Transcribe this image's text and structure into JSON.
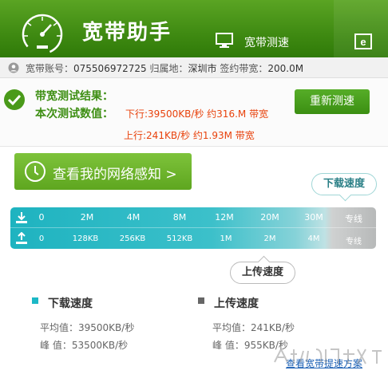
{
  "header": {
    "app_title": "宽带助手",
    "tab_speed_label": "宽带测速"
  },
  "info_bar": {
    "account_label": "宽带账号：",
    "account_value": "075506972725",
    "location_label": "归属地：",
    "location_value": "深圳市",
    "bandwidth_label": "签约带宽：",
    "bandwidth_value": "200.0M"
  },
  "result": {
    "title": "带宽测试结果：",
    "subtitle": "本次测试数值：",
    "download": "下行:39500KB/秒 约316.M 带宽",
    "upload": "上行:241KB/秒 约1.93M 带宽",
    "retest_label": "重新测速"
  },
  "network_button": {
    "label": "查看我的网络感知 >"
  },
  "callouts": {
    "download": "下载速度",
    "upload": "上传速度"
  },
  "scale": {
    "download_ticks": [
      "0",
      "2M",
      "4M",
      "8M",
      "12M",
      "20M",
      "30M",
      "专线"
    ],
    "upload_ticks": [
      "0",
      "128KB",
      "256KB",
      "512KB",
      "1M",
      "2M",
      "4M",
      "专线"
    ]
  },
  "stats": {
    "download": {
      "title": "下载速度",
      "avg": "平均值：39500KB/秒",
      "peak": "峰  值：53500KB/秒",
      "color": "#1cb8c6"
    },
    "upload": {
      "title": "上传速度",
      "avg": "平均值：241KB/秒",
      "peak": "峰  值：955KB/秒",
      "color": "#666666"
    }
  },
  "view_link": "查看宽带提速方案",
  "colors": {
    "header_green": "#4a9a1a",
    "accent_teal": "#1eb3c0",
    "alert_orange": "#e8420c"
  }
}
